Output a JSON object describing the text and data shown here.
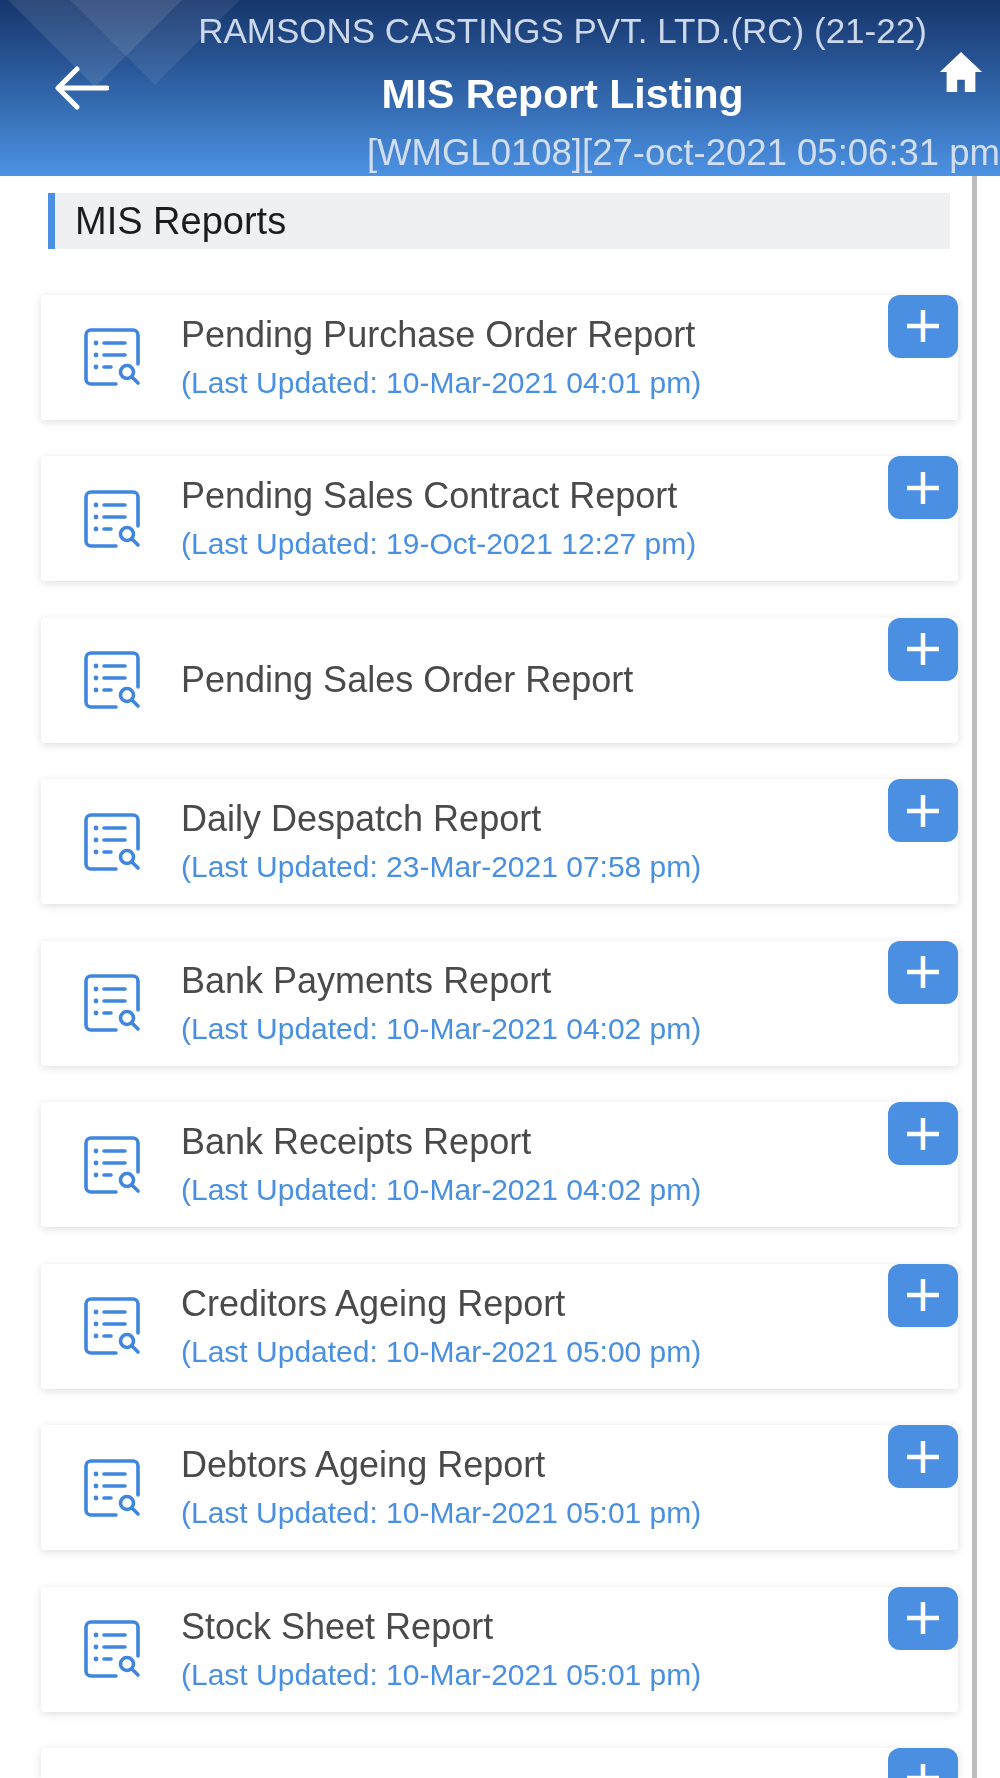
{
  "header": {
    "company": "RAMSONS CASTINGS PVT. LTD.(RC) (21-22)",
    "title": "MIS Report Listing",
    "session": "[WMGL0108][27-oct-2021 05:06:31 pm"
  },
  "section": {
    "title": "MIS Reports"
  },
  "reports": [
    {
      "title": "Pending Purchase Order Report",
      "last_updated": "(Last Updated: 10-Mar-2021 04:01 pm)"
    },
    {
      "title": "Pending Sales Contract Report",
      "last_updated": "(Last Updated: 19-Oct-2021 12:27 pm)"
    },
    {
      "title": "Pending Sales Order Report"
    },
    {
      "title": "Daily Despatch Report",
      "last_updated": "(Last Updated: 23-Mar-2021 07:58 pm)"
    },
    {
      "title": "Bank Payments Report",
      "last_updated": "(Last Updated: 10-Mar-2021 04:02 pm)"
    },
    {
      "title": "Bank Receipts Report",
      "last_updated": "(Last Updated: 10-Mar-2021 04:02 pm)"
    },
    {
      "title": "Creditors Ageing Report",
      "last_updated": "(Last Updated: 10-Mar-2021 05:00 pm)"
    },
    {
      "title": "Debtors Ageing Report",
      "last_updated": "(Last Updated: 10-Mar-2021 05:01 pm)"
    },
    {
      "title": "Stock Sheet Report",
      "last_updated": "(Last Updated: 10-Mar-2021 05:01 pm)"
    }
  ],
  "next_report_partly_visible": true
}
